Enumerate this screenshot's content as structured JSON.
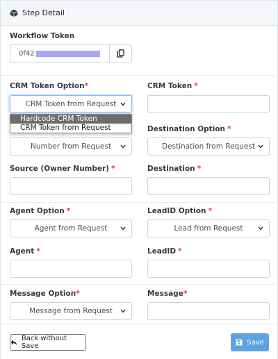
{
  "header": {
    "title": "Step Detail",
    "icon": "cube-icon"
  },
  "workflow_token": {
    "label": "Workflow Token",
    "value": "0f42",
    "copy_icon": "copy-icon"
  },
  "crm_token_option": {
    "label": "CRM Token Option",
    "required_mark": "*",
    "selected": "CRM Token from Request",
    "options": [
      "Hardcode CRM Token",
      "CRM Token from Request"
    ],
    "highlighted_option": "Hardcode CRM Token"
  },
  "crm_token": {
    "label": "CRM Token",
    "required_mark": "*",
    "value": ""
  },
  "source_option": {
    "selected": "Number from Request"
  },
  "destination_option": {
    "label": "Destination Option",
    "required_mark": "*",
    "selected": "Destination from Request"
  },
  "source_owner_number": {
    "label": "Source (Owner Number)",
    "required_mark": "*",
    "value": ""
  },
  "destination": {
    "label": "Destination",
    "required_mark": "*",
    "value": ""
  },
  "agent_option": {
    "label": "Agent Option",
    "required_mark": "*",
    "selected": "Agent from Request"
  },
  "leadid_option": {
    "label": "LeadID Option",
    "required_mark": "*",
    "selected": "Lead from Request"
  },
  "agent": {
    "label": "Agent",
    "required_mark": "*",
    "value": ""
  },
  "leadid": {
    "label": "LeadID",
    "required_mark": "*",
    "value": ""
  },
  "message_option": {
    "label": "Message Option",
    "required_mark": "*",
    "selected": "Message from Request"
  },
  "message": {
    "label": "Message",
    "required_mark": "*",
    "value": ""
  },
  "footer": {
    "back_label": "Back without Save",
    "save_label": "Save"
  },
  "colors": {
    "header_bg": "#f4f6f9",
    "required": "#dc3545",
    "save_button": "#5da3e0",
    "focus_border": "#80bdff"
  }
}
